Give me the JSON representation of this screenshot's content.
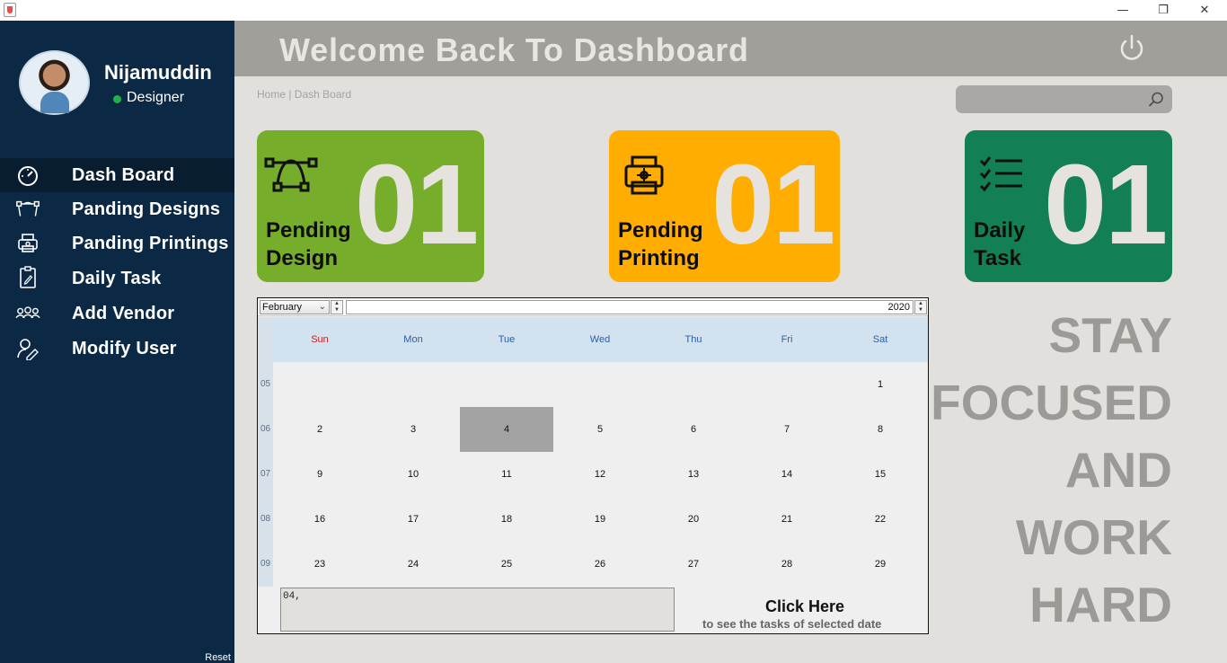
{
  "window": {
    "minimize": "—",
    "maximize": "❐",
    "close": "✕"
  },
  "user": {
    "name": "Nijamuddin",
    "role": "Designer",
    "status_color": "#20b14a"
  },
  "nav": {
    "items": [
      {
        "label": "Dash Board",
        "icon": "gauge-icon",
        "active": true
      },
      {
        "label": "Panding Designs",
        "icon": "bezier-pen-icon"
      },
      {
        "label": "Panding Printings",
        "icon": "printer-icon"
      },
      {
        "label": "Daily Task",
        "icon": "clipboard-icon"
      },
      {
        "label": "Add Vendor",
        "icon": "users-icon"
      },
      {
        "label": "Modify User",
        "icon": "user-edit-icon"
      }
    ],
    "reset": "Reset"
  },
  "header": {
    "title": "Welcome Back To Dashboard"
  },
  "breadcrumb": "Home | Dash Board",
  "search": {
    "value": "",
    "placeholder": ""
  },
  "cards": [
    {
      "label_line1": "Pending",
      "label_line2": "Design",
      "count": "01",
      "color": "#76ad2a",
      "icon": "bezier-curve-icon"
    },
    {
      "label_line1": "Pending",
      "label_line2": "Printing",
      "count": "01",
      "color": "#ffad00",
      "icon": "printer-gear-icon"
    },
    {
      "label_line1": "Daily",
      "label_line2": "Task",
      "count": "01",
      "color": "#127f55",
      "icon": "checklist-icon"
    }
  ],
  "calendar": {
    "month": "February",
    "year": "2020",
    "days_of_week": [
      "Sun",
      "Mon",
      "Tue",
      "Wed",
      "Thu",
      "Fri",
      "Sat"
    ],
    "weeks": [
      {
        "num": "05",
        "days": [
          "",
          "",
          "",
          "",
          "",
          "",
          "1"
        ]
      },
      {
        "num": "06",
        "days": [
          "2",
          "3",
          "4",
          "5",
          "6",
          "7",
          "8"
        ]
      },
      {
        "num": "07",
        "days": [
          "9",
          "10",
          "11",
          "12",
          "13",
          "14",
          "15"
        ]
      },
      {
        "num": "08",
        "days": [
          "16",
          "17",
          "18",
          "19",
          "20",
          "21",
          "22"
        ]
      },
      {
        "num": "09",
        "days": [
          "23",
          "24",
          "25",
          "26",
          "27",
          "28",
          "29"
        ]
      }
    ],
    "selected_day": "4",
    "task_text": "04,",
    "click_title": "Click Here",
    "click_sub": "to see the tasks of selected date"
  },
  "motto": [
    "STAY",
    "FOCUSED",
    "AND",
    "WORK",
    "HARD"
  ]
}
